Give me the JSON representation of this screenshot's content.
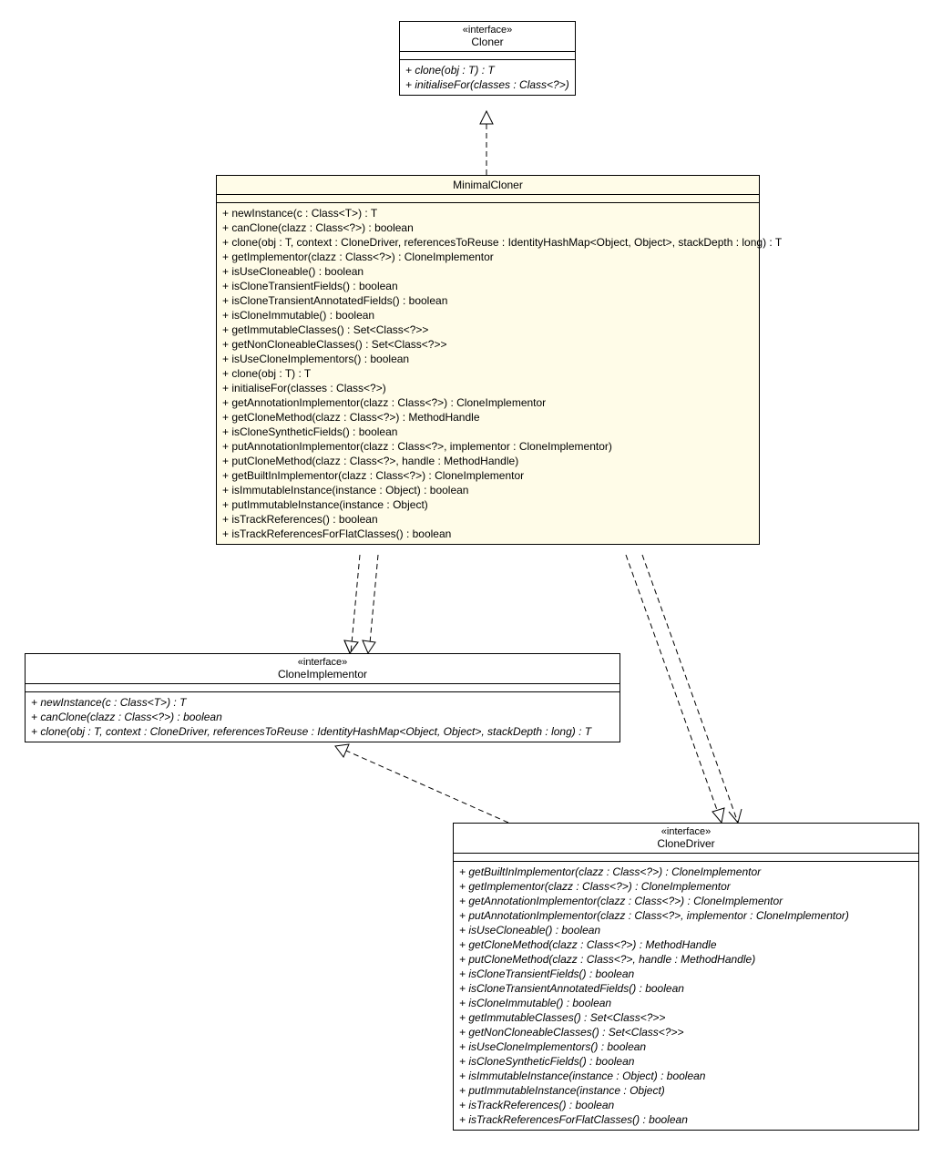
{
  "cloner": {
    "stereo": "«interface»",
    "name": "Cloner",
    "methods": [
      {
        "sig": "+ clone(obj : T) : T",
        "italic": true
      },
      {
        "sig": "+ initialiseFor(classes : Class<?>)",
        "italic": true
      }
    ]
  },
  "minimalCloner": {
    "name": "MinimalCloner",
    "methods": [
      {
        "sig": "+ newInstance(c : Class<T>) : T",
        "italic": false
      },
      {
        "sig": "+ canClone(clazz : Class<?>) : boolean",
        "italic": false
      },
      {
        "sig": "+ clone(obj : T, context : CloneDriver, referencesToReuse : IdentityHashMap<Object, Object>, stackDepth : long) : T",
        "italic": false
      },
      {
        "sig": "+ getImplementor(clazz : Class<?>) : CloneImplementor",
        "italic": false
      },
      {
        "sig": "+ isUseCloneable() : boolean",
        "italic": false
      },
      {
        "sig": "+ isCloneTransientFields() : boolean",
        "italic": false
      },
      {
        "sig": "+ isCloneTransientAnnotatedFields() : boolean",
        "italic": false
      },
      {
        "sig": "+ isCloneImmutable() : boolean",
        "italic": false
      },
      {
        "sig": "+ getImmutableClasses() : Set<Class<?>>",
        "italic": false
      },
      {
        "sig": "+ getNonCloneableClasses() : Set<Class<?>>",
        "italic": false
      },
      {
        "sig": "+ isUseCloneImplementors() : boolean",
        "italic": false
      },
      {
        "sig": "+ clone(obj : T) : T",
        "italic": false
      },
      {
        "sig": "+ initialiseFor(classes : Class<?>)",
        "italic": false
      },
      {
        "sig": "+ getAnnotationImplementor(clazz : Class<?>) : CloneImplementor",
        "italic": false
      },
      {
        "sig": "+ getCloneMethod(clazz : Class<?>) : MethodHandle",
        "italic": false
      },
      {
        "sig": "+ isCloneSyntheticFields() : boolean",
        "italic": false
      },
      {
        "sig": "+ putAnnotationImplementor(clazz : Class<?>, implementor : CloneImplementor)",
        "italic": false
      },
      {
        "sig": "+ putCloneMethod(clazz : Class<?>, handle : MethodHandle)",
        "italic": false
      },
      {
        "sig": "+ getBuiltInImplementor(clazz : Class<?>) : CloneImplementor",
        "italic": false
      },
      {
        "sig": "+ isImmutableInstance(instance : Object) : boolean",
        "italic": false
      },
      {
        "sig": "+ putImmutableInstance(instance : Object)",
        "italic": false
      },
      {
        "sig": "+ isTrackReferences() : boolean",
        "italic": false
      },
      {
        "sig": "+ isTrackReferencesForFlatClasses() : boolean",
        "italic": false
      }
    ]
  },
  "cloneImplementor": {
    "stereo": "«interface»",
    "name": "CloneImplementor",
    "methods": [
      {
        "sig": "+ newInstance(c : Class<T>) : T",
        "italic": true
      },
      {
        "sig": "+ canClone(clazz : Class<?>) : boolean",
        "italic": true
      },
      {
        "sig": "+ clone(obj : T, context : CloneDriver, referencesToReuse : IdentityHashMap<Object, Object>, stackDepth : long) : T",
        "italic": true
      }
    ]
  },
  "cloneDriver": {
    "stereo": "«interface»",
    "name": "CloneDriver",
    "methods": [
      {
        "sig": "+ getBuiltInImplementor(clazz : Class<?>) : CloneImplementor",
        "italic": true
      },
      {
        "sig": "+ getImplementor(clazz : Class<?>) : CloneImplementor",
        "italic": true
      },
      {
        "sig": "+ getAnnotationImplementor(clazz : Class<?>) : CloneImplementor",
        "italic": true
      },
      {
        "sig": "+ putAnnotationImplementor(clazz : Class<?>, implementor : CloneImplementor)",
        "italic": true
      },
      {
        "sig": "+ isUseCloneable() : boolean",
        "italic": true
      },
      {
        "sig": "+ getCloneMethod(clazz : Class<?>) : MethodHandle",
        "italic": true
      },
      {
        "sig": "+ putCloneMethod(clazz : Class<?>, handle : MethodHandle)",
        "italic": true
      },
      {
        "sig": "+ isCloneTransientFields() : boolean",
        "italic": true
      },
      {
        "sig": "+ isCloneTransientAnnotatedFields() : boolean",
        "italic": true
      },
      {
        "sig": "+ isCloneImmutable() : boolean",
        "italic": true
      },
      {
        "sig": "+ getImmutableClasses() : Set<Class<?>>",
        "italic": true
      },
      {
        "sig": "+ getNonCloneableClasses() : Set<Class<?>>",
        "italic": true
      },
      {
        "sig": "+ isUseCloneImplementors() : boolean",
        "italic": true
      },
      {
        "sig": "+ isCloneSyntheticFields() : boolean",
        "italic": true
      },
      {
        "sig": "+ isImmutableInstance(instance : Object) : boolean",
        "italic": true
      },
      {
        "sig": "+ putImmutableInstance(instance : Object)",
        "italic": true
      },
      {
        "sig": "+ isTrackReferences() : boolean",
        "italic": true
      },
      {
        "sig": "+ isTrackReferencesForFlatClasses() : boolean",
        "italic": true
      }
    ]
  }
}
